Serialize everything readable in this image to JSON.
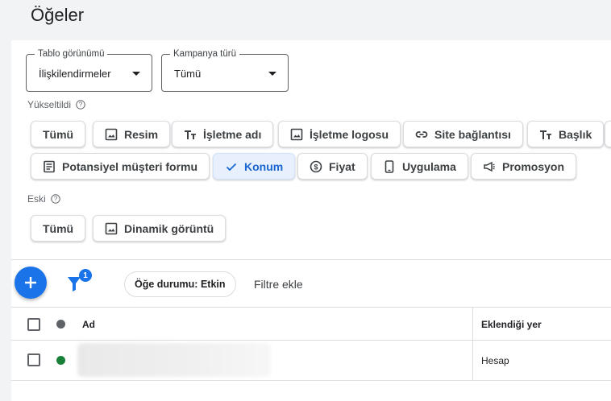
{
  "page": {
    "title": "Öğeler"
  },
  "filters": {
    "table_view": {
      "label": "Tablo görünümü",
      "value": "İlişkilendirmeler"
    },
    "campaign_type": {
      "label": "Kampanya türü",
      "value": "Tümü"
    }
  },
  "upgraded": {
    "label": "Yükseltildi",
    "chips": [
      {
        "label": "Tümü",
        "icon": ""
      },
      {
        "label": "Resim",
        "icon": "image-icon"
      },
      {
        "label": "İşletme adı",
        "icon": "text-icon"
      },
      {
        "label": "İşletme logosu",
        "icon": "image-icon"
      },
      {
        "label": "Site bağlantısı",
        "icon": "link-icon"
      },
      {
        "label": "Başlık",
        "icon": "text-icon"
      }
    ],
    "chips_row2": [
      {
        "label": "Potansiyel müşteri formu",
        "icon": "form-icon"
      },
      {
        "label": "Konum",
        "icon": "check-icon",
        "selected": true
      },
      {
        "label": "Fiyat",
        "icon": "price-icon"
      },
      {
        "label": "Uygulama",
        "icon": "phone-icon"
      },
      {
        "label": "Promosyon",
        "icon": "megaphone-icon"
      }
    ]
  },
  "legacy": {
    "label": "Eski",
    "chips": [
      {
        "label": "Tümü",
        "icon": ""
      },
      {
        "label": "Dinamik görüntü",
        "icon": "image-icon"
      }
    ]
  },
  "toolbar": {
    "filter_count": "1",
    "status_filter": "Öğe durumu: Etkin",
    "add_filter": "Filtre ekle"
  },
  "table": {
    "columns": {
      "name": "Ad",
      "added_at": "Eklendiği yer"
    },
    "rows": [
      {
        "added_at": "Hesap",
        "status_color": "#188038"
      }
    ]
  },
  "colors": {
    "accent": "#1a73e8",
    "selected_chip_bg": "#e8f0fe",
    "status_active": "#188038",
    "header_dot": "#5f6368"
  }
}
